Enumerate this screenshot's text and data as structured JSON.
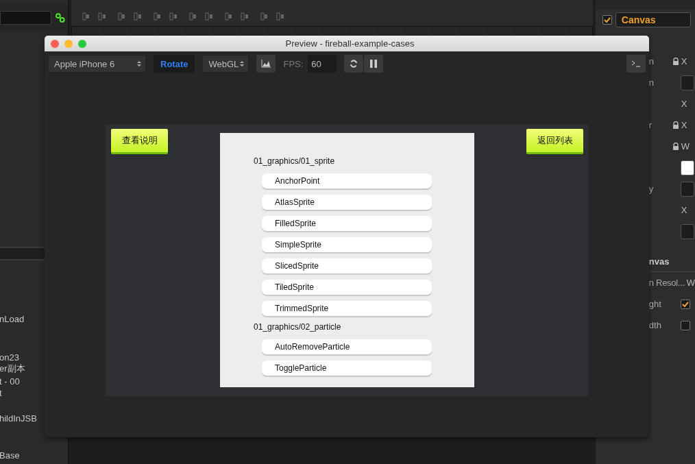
{
  "left_panel": {
    "items": [
      "nLoad",
      "on23",
      "er副本",
      "t - 00",
      "t",
      "hildInJSB",
      "Base"
    ]
  },
  "inspector": {
    "component": {
      "label": "Canvas",
      "checked": true
    },
    "rows": [
      {
        "kind": "axis",
        "label": "n",
        "locked": true,
        "axis": "X"
      },
      {
        "kind": "field",
        "label": "n"
      },
      {
        "kind": "axis",
        "axis": "X"
      },
      {
        "kind": "axis",
        "label": "r",
        "locked": true,
        "axis": "X"
      },
      {
        "kind": "axis",
        "locked": true,
        "axis": "W"
      },
      {
        "kind": "light-field"
      },
      {
        "kind": "field",
        "label": "y"
      },
      {
        "kind": "axis",
        "axis": "X"
      },
      {
        "kind": "field"
      }
    ],
    "section": "nvas",
    "section_rows": [
      {
        "label": "n Resol...",
        "axis": "W"
      },
      {
        "label": "ght",
        "checked": true
      },
      {
        "label": "dth",
        "checked": false
      }
    ]
  },
  "preview_window": {
    "title": "Preview - fireball-example-cases",
    "toolbar": {
      "device": "Apple iPhone 6",
      "rotate": {
        "label": "Rotate",
        "selected": true
      },
      "renderer": "WebGL",
      "fps_label": "FPS:",
      "fps_value": "60"
    },
    "game": {
      "left_button": "查看说明",
      "right_button": "返回列表",
      "groups": [
        {
          "heading": "01_graphics/01_sprite",
          "items": [
            "AnchorPoint",
            "AtlasSprite",
            "FilledSprite",
            "SimpleSprite",
            "SlicedSprite",
            "TiledSprite",
            "TrimmedSprite"
          ]
        },
        {
          "heading": "01_graphics/02_particle",
          "items": [
            "AutoRemoveParticle",
            "ToggleParticle"
          ]
        }
      ]
    }
  }
}
